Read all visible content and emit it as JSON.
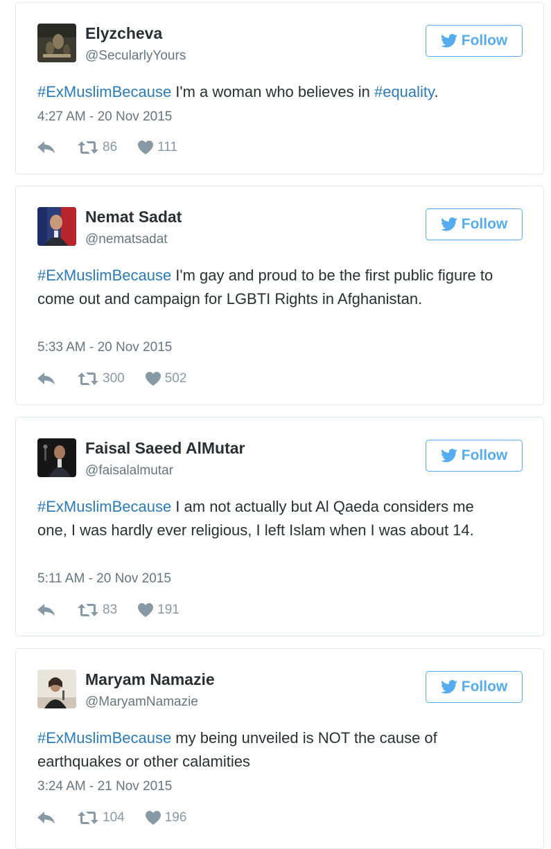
{
  "follow_label": "Follow",
  "colors": {
    "link": "#2b7bb9",
    "twitter_blue": "#55acee",
    "muted": "#66757f",
    "icon": "#8899a6",
    "text": "#292f33"
  },
  "tweets": [
    {
      "name": "Elyzcheva",
      "handle": "@SecularlyYours",
      "hashtag": "#ExMuslimBecause",
      "text_1": " I'm a woman who believes in ",
      "hashtag2": "#equality",
      "text_2": ".",
      "time": "4:27 AM - 20 Nov 2015",
      "retweets": "86",
      "likes": "111"
    },
    {
      "name": "Nemat Sadat",
      "handle": "@nematsadat",
      "hashtag": "#ExMuslimBecause",
      "text": " I'm gay and proud to be the first public figure to come out and campaign for LGBTI Rights in Afghanistan.",
      "time": "5:33 AM - 20 Nov 2015",
      "retweets": "300",
      "likes": "502"
    },
    {
      "name": "Faisal Saeed AlMutar",
      "handle": "@faisalalmutar",
      "hashtag": "#ExMuslimBecause",
      "text": " I am not actually but Al Qaeda considers me one, I was hardly ever religious, I left Islam when I was about 14.",
      "time": "5:11 AM - 20 Nov 2015",
      "retweets": "83",
      "likes": "191"
    },
    {
      "name": "Maryam Namazie",
      "handle": "@MaryamNamazie",
      "hashtag": "#ExMuslimBecause",
      "text": " my being unveiled is NOT the cause of earthquakes or other calamities",
      "time": "3:24 AM - 21 Nov 2015",
      "retweets": "104",
      "likes": "196"
    }
  ]
}
